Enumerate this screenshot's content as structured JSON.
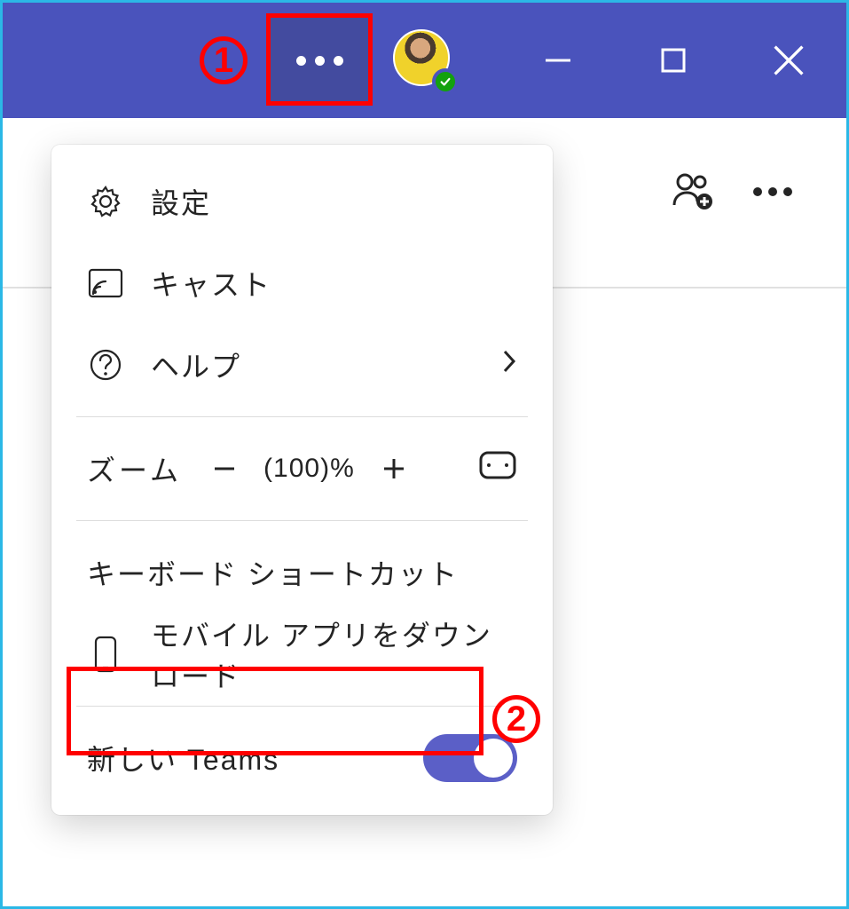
{
  "annotations": {
    "step1": "1",
    "step2": "2"
  },
  "titlebar": {
    "presence": "available"
  },
  "behind": {
    "addPeopleIcon": "add-people",
    "moreIcon": "more"
  },
  "menu": {
    "settings": "設定",
    "cast": "キャスト",
    "help": "ヘルプ",
    "zoom_label": "ズーム",
    "zoom_value": "(100)%",
    "keyboard_shortcuts": "キーボード ショートカット",
    "download_mobile": "モバイル アプリをダウンロード",
    "new_teams": "新しい Teams",
    "new_teams_on": true
  }
}
